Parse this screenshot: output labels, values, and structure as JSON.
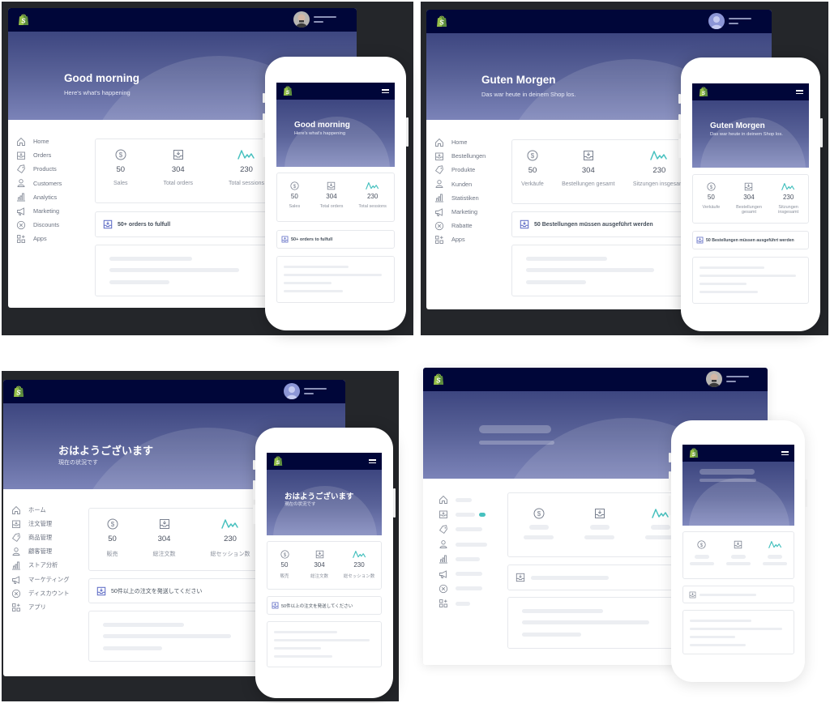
{
  "colors": {
    "topbar": "#000639",
    "hero_top": "#3d4680",
    "hero_bottom": "#7b83b8",
    "accent_teal": "#47c1bf",
    "icon_blue": "#5c6ac4",
    "dark_frame": "#24262a",
    "shopify_green": "#95bf47"
  },
  "icons": {
    "logo": "shopify-bag-icon",
    "avatar": "user-avatar",
    "menu": "hamburger-icon",
    "nav": [
      "home-icon",
      "orders-icon",
      "tag-icon",
      "person-icon",
      "bar-chart-icon",
      "megaphone-icon",
      "discount-icon",
      "apps-icon"
    ],
    "metrics": [
      "dollar-icon",
      "inbox-icon",
      "sparkline-icon"
    ]
  },
  "variants": [
    {
      "lang": "en",
      "hero": {
        "title": "Good morning",
        "subtitle": "Here's what's happening"
      },
      "nav": [
        "Home",
        "Orders",
        "Products",
        "Customers",
        "Analytics",
        "Marketing",
        "Discounts",
        "Apps"
      ],
      "metrics": [
        {
          "value": "50",
          "label": "Sales"
        },
        {
          "value": "304",
          "label": "Total orders"
        },
        {
          "value": "230",
          "label": "Total sessions"
        }
      ],
      "fulfill": "50+ orders to fulfull",
      "mobile": {
        "hero": {
          "title": "Good morning",
          "subtitle": "Here's what's happening"
        },
        "metrics": [
          {
            "value": "50",
            "label": "Sales"
          },
          {
            "value": "304",
            "label": "Total orders"
          },
          {
            "value": "230",
            "label": "Total sessions"
          }
        ],
        "fulfill": "50+ orders to fulfull"
      }
    },
    {
      "lang": "de",
      "hero": {
        "title": "Guten Morgen",
        "subtitle": "Das war heute in deinem Shop los."
      },
      "nav": [
        "Home",
        "Bestellungen",
        "Produkte",
        "Kunden",
        "Statistiken",
        "Marketing",
        "Rabatte",
        "Apps"
      ],
      "metrics": [
        {
          "value": "50",
          "label": "Verkäufe"
        },
        {
          "value": "304",
          "label": "Bestellungen gesamt"
        },
        {
          "value": "230",
          "label": "Sitzungen insgesamt"
        }
      ],
      "fulfill": "50 Bestellungen müssen ausgeführt werden",
      "mobile": {
        "hero": {
          "title": "Guten Morgen",
          "subtitle": "Das war heute in deinem Shop los."
        },
        "metrics": [
          {
            "value": "50",
            "label": "Verkäufe"
          },
          {
            "value": "304",
            "label": "Bestellungen gesamt"
          },
          {
            "value": "230",
            "label": "Sitzungen insgesamt"
          }
        ],
        "fulfill": "50 Bestellungen müssen ausgeführt werden"
      }
    },
    {
      "lang": "ja",
      "hero": {
        "title": "おはようございます",
        "subtitle": "現在の状況です"
      },
      "nav": [
        "ホーム",
        "注文管理",
        "商品管理",
        "顧客管理",
        "ストア分析",
        "マーケティング",
        "ディスカウント",
        "アプリ"
      ],
      "metrics": [
        {
          "value": "50",
          "label": "販売"
        },
        {
          "value": "304",
          "label": "総注文数"
        },
        {
          "value": "230",
          "label": "総セッション数"
        }
      ],
      "fulfill": "50件以上の注文を発送してください",
      "mobile": {
        "hero": {
          "title": "おはようございます",
          "subtitle": "現在の状況です"
        },
        "metrics": [
          {
            "value": "50",
            "label": "販売"
          },
          {
            "value": "304",
            "label": "総注文数"
          },
          {
            "value": "230",
            "label": "総セッション数"
          }
        ],
        "fulfill": "50件以上の注文を発送してください"
      }
    },
    {
      "lang": "skeleton",
      "nav_badge": true
    }
  ]
}
